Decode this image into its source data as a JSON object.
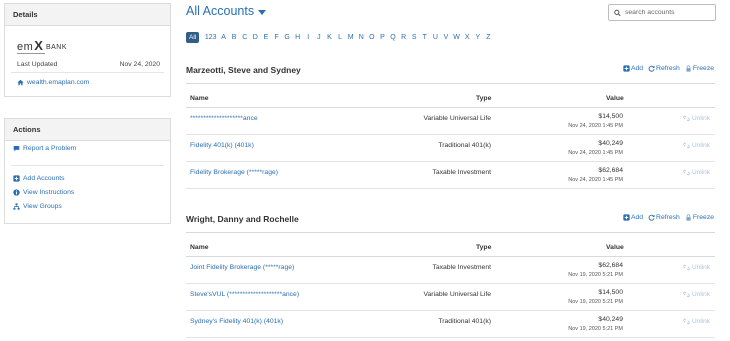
{
  "sidebar": {
    "details": {
      "heading": "Details",
      "logo_prefix": "em",
      "logo_x": "X",
      "logo_bank": "BANK",
      "updated_label": "Last Updated",
      "updated_value": "Nov 24, 2020",
      "site_link": "wealth.emaplan.com"
    },
    "actions": {
      "heading": "Actions",
      "items": [
        "Report a Problem",
        "Add Accounts",
        "View Instructions",
        "View Groups"
      ]
    }
  },
  "header": {
    "title": "All Accounts",
    "search_placeholder": "search accounts"
  },
  "alpha_filter": [
    "All",
    "123",
    "A",
    "B",
    "C",
    "D",
    "E",
    "F",
    "G",
    "H",
    "I",
    "J",
    "K",
    "L",
    "M",
    "N",
    "O",
    "P",
    "Q",
    "R",
    "S",
    "T",
    "U",
    "V",
    "W",
    "X",
    "Y",
    "Z"
  ],
  "group_actions": {
    "add": "Add",
    "refresh": "Refresh",
    "freeze": "Freeze"
  },
  "columns": {
    "name": "Name",
    "type": "Type",
    "value": "Value"
  },
  "unlink_label": "Unlink",
  "groups": [
    {
      "title": "Marzeotti, Steve and Sydney",
      "rows": [
        {
          "name": "********************ance",
          "type": "Variable Universal Life",
          "value": "$14,500",
          "date": "Nov 24, 2020 1:45 PM"
        },
        {
          "name": "Fidelity 401(k) (401k)",
          "type": "Traditional 401(k)",
          "value": "$40,249",
          "date": "Nov 24, 2020 1:45 PM"
        },
        {
          "name": "Fidelity Brokerage (*****rage)",
          "type": "Taxable Investment",
          "value": "$62,684",
          "date": "Nov 24, 2020 1:45 PM"
        }
      ]
    },
    {
      "title": "Wright, Danny and Rochelle",
      "rows": [
        {
          "name": "Joint Fidelity Brokerage (*****rage)",
          "type": "Taxable Investment",
          "value": "$62,684",
          "date": "Nov 19, 2020 5:21 PM"
        },
        {
          "name": "Steve'sVUL (********************ance)",
          "type": "Variable Universal Life",
          "value": "$14,500",
          "date": "Nov 19, 2020 5:21 PM"
        },
        {
          "name": "Sydney's Fidelity 401(k) (401k)",
          "type": "Traditional 401(k)",
          "value": "$40,249",
          "date": "Nov 19, 2020 5:21 PM"
        }
      ]
    }
  ],
  "colors": {
    "link": "#2a6fb5",
    "all_badge": "#2f5e86",
    "unlink": "#aac4de"
  }
}
